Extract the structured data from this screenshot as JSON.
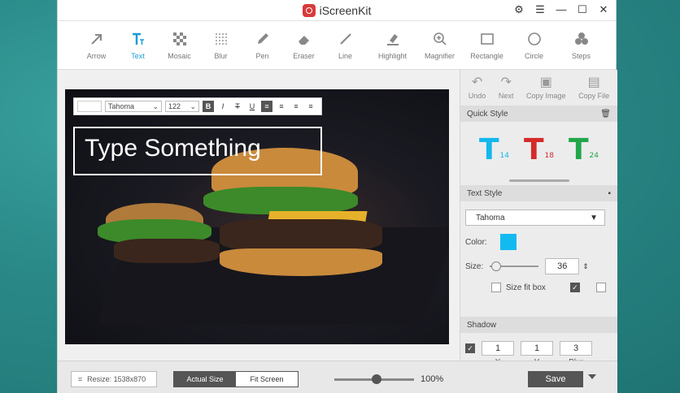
{
  "app": {
    "title": "iScreenKit"
  },
  "toolbar": {
    "tools": [
      "Arrow",
      "Text",
      "Mosaic",
      "Blur",
      "Pen",
      "Eraser",
      "Line",
      "Highlight",
      "Magnifier",
      "Rectangle",
      "Circle",
      "Steps"
    ],
    "active": "Text"
  },
  "editor": {
    "font": "Tahoma",
    "font_size": "122",
    "placeholder_text": "Type Something"
  },
  "sidebar": {
    "actions": [
      "Undo",
      "Next",
      "Copy Image",
      "Copy File"
    ],
    "quick_style": {
      "title": "Quick Style",
      "items": [
        {
          "label": "T",
          "size": "14",
          "color": "#13b8ec"
        },
        {
          "label": "T",
          "size": "18",
          "color": "#d42b2b"
        },
        {
          "label": "T",
          "size": "24",
          "color": "#22a64a"
        }
      ]
    },
    "text_style": {
      "title": "Text Style",
      "font": "Tahoma",
      "color_label": "Color:",
      "color_value": "#13baf0",
      "size_label": "Size:",
      "size_value": "36",
      "size_fit_label": "Size fit box"
    },
    "shadow": {
      "title": "Shadow",
      "x": "1",
      "y": "1",
      "blur": "3",
      "labels": [
        "X",
        "Y",
        "Blur"
      ]
    }
  },
  "status": {
    "resize_label": "Resize: 1538x870",
    "actual_size": "Actual Size",
    "fit_screen": "Fit Screen",
    "zoom": "100%",
    "save": "Save"
  }
}
